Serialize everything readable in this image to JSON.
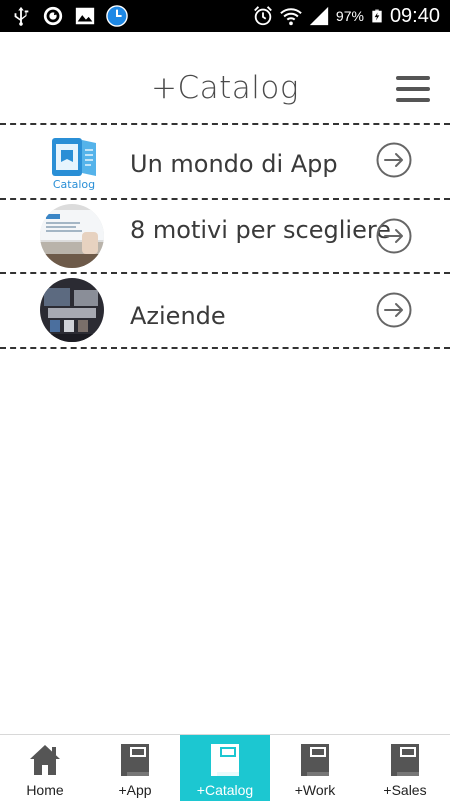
{
  "status_bar": {
    "battery_percent": "97%",
    "time": "09:40",
    "icons": [
      "usb-icon",
      "sync-icon",
      "image-icon",
      "clock-icon",
      "alarm-icon",
      "wifi-icon",
      "signal-icon",
      "battery-icon"
    ]
  },
  "header": {
    "title": "+Catalog",
    "menu_icon": "hamburger-icon"
  },
  "list": {
    "items": [
      {
        "label": "Un mondo di App",
        "thumb_text": "Catalog",
        "icon": "arrow-right-circle-icon"
      },
      {
        "label": "8 motivi per scegliere",
        "icon": "arrow-right-circle-icon"
      },
      {
        "label": "Aziende",
        "icon": "arrow-right-circle-icon"
      }
    ]
  },
  "tabbar": {
    "active_color": "#1cc7d1",
    "tabs": [
      {
        "label": "Home",
        "icon": "home-icon",
        "active": false
      },
      {
        "label": "+App",
        "icon": "book-icon",
        "active": false
      },
      {
        "label": "+Catalog",
        "icon": "book-icon",
        "active": true
      },
      {
        "label": "+Work",
        "icon": "book-icon",
        "active": false
      },
      {
        "label": "+Sales",
        "icon": "book-icon",
        "active": false
      }
    ]
  }
}
